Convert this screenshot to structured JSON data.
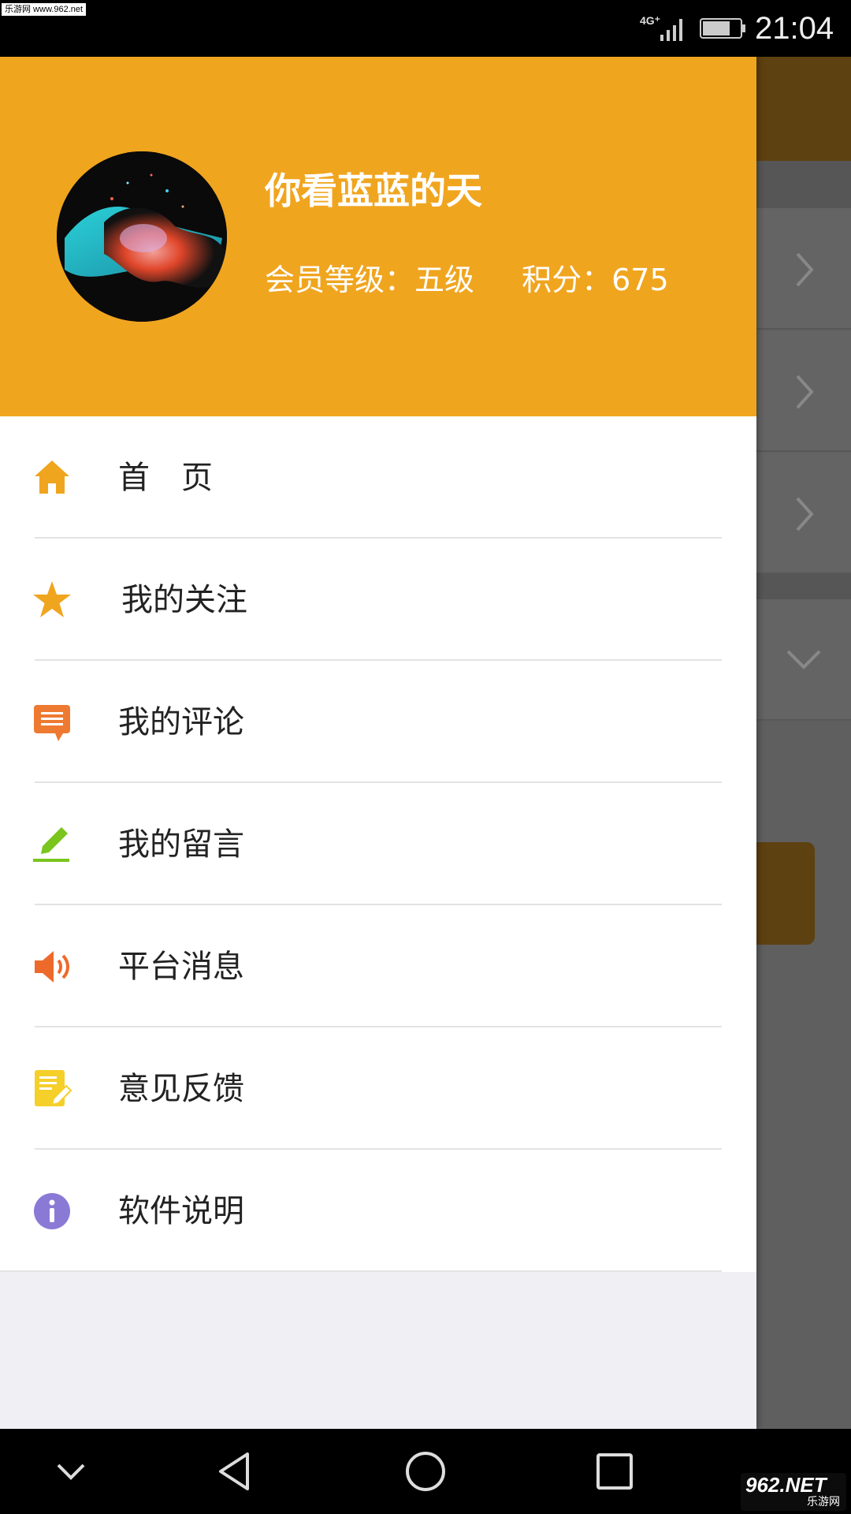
{
  "status_bar": {
    "watermark": "乐游网 www.962.net",
    "network_type": "4G⁺",
    "time": "21:04"
  },
  "profile": {
    "username": "你看蓝蓝的天",
    "member_level_label": "会员等级：五级",
    "points_label": "积分：675"
  },
  "menu": {
    "items": [
      {
        "label": "首　页",
        "icon": "home-icon",
        "color": "#f0a51f"
      },
      {
        "label": "我的关注",
        "icon": "star-icon",
        "color": "#f0a51f"
      },
      {
        "label": "我的评论",
        "icon": "comment-icon",
        "color": "#ee7a32"
      },
      {
        "label": "我的留言",
        "icon": "pencil-icon",
        "color": "#7ac51e"
      },
      {
        "label": "平台消息",
        "icon": "speaker-icon",
        "color": "#ee6a2a"
      },
      {
        "label": "意见反馈",
        "icon": "feedback-icon",
        "color": "#f5cf2a"
      },
      {
        "label": "软件说明",
        "icon": "info-icon",
        "color": "#8a7ad6"
      }
    ]
  },
  "watermark_bottom": {
    "main": "962.NET",
    "sub": "乐游网"
  },
  "colors": {
    "header": "#f0a51f",
    "drawer_bg": "#efeff4",
    "menu_bg": "#ffffff"
  }
}
